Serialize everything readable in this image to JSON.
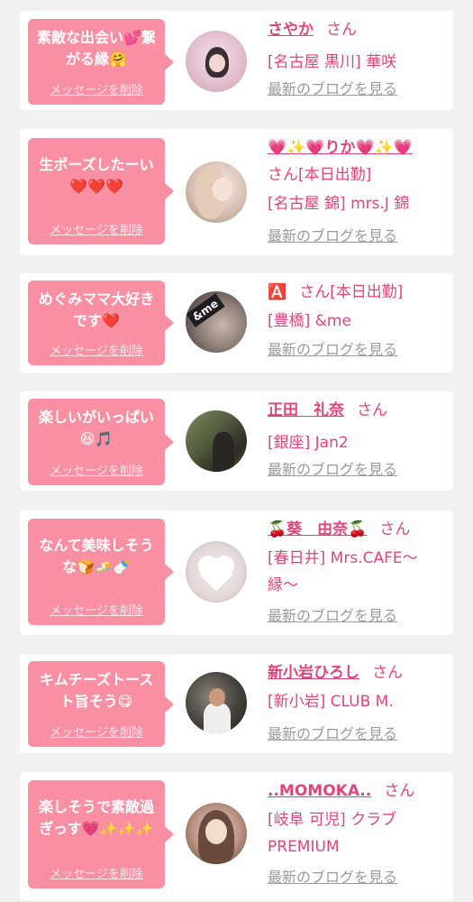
{
  "cards": [
    {
      "msg1": "素敵な出会い💕繋",
      "msg2": "がる縁🤗",
      "del": "メッセージを削除",
      "name": "さやか",
      "san": "さん",
      "shop": "[名古屋 黒川] 華咲",
      "blog": "最新のブログを見る"
    },
    {
      "msg1": "生ポーズしたーい",
      "msg2": "❤️❤️❤️",
      "del": "メッセージを削除",
      "name": "💗✨💗りか💗✨💗",
      "san": "さん[本日出勤]",
      "shop": "[名古屋 錦] mrs.J 錦",
      "blog": "最新のブログを見る"
    },
    {
      "msg1": "めぐみママ大好き",
      "msg2": "です❤️",
      "del": "メッセージを削除",
      "name": "🅰️",
      "san": "さん[本日出勤]",
      "shop": "[豊橋] &me",
      "blog": "最新のブログを見る",
      "avatar_text": "&me"
    },
    {
      "msg1": "楽しいがいっぱい",
      "msg2": "😆🎵",
      "del": "メッセージを削除",
      "name": "正田　礼奈",
      "san": "さん",
      "shop": "[銀座] Jan2",
      "blog": "最新のブログを見る"
    },
    {
      "msg1": "なんて美味しそう",
      "msg2": "な🍞🧈🍼",
      "del": "メッセージを削除",
      "name": "🍒葵　由奈🍒",
      "san": "さん",
      "shop": "[春日井] Mrs.CAFE～",
      "shop2": "縁～",
      "blog": "最新のブログを見る"
    },
    {
      "msg1": "キムチーズトース",
      "msg2": "ト旨そう😋",
      "del": "メッセージを削除",
      "name": "新小岩ひろし",
      "san": "さん",
      "shop": "[新小岩] CLUB M.",
      "blog": "最新のブログを見る"
    },
    {
      "msg1": "楽しそうで素敵過",
      "msg2": "ぎっす💗✨✨✨",
      "del": "メッセージを削除",
      "name": "..MOMOKA..",
      "san": "さん",
      "shop": "[岐阜 可児] クラブ",
      "shop2": "PREMIUM",
      "blog": "最新のブログを見る"
    }
  ]
}
